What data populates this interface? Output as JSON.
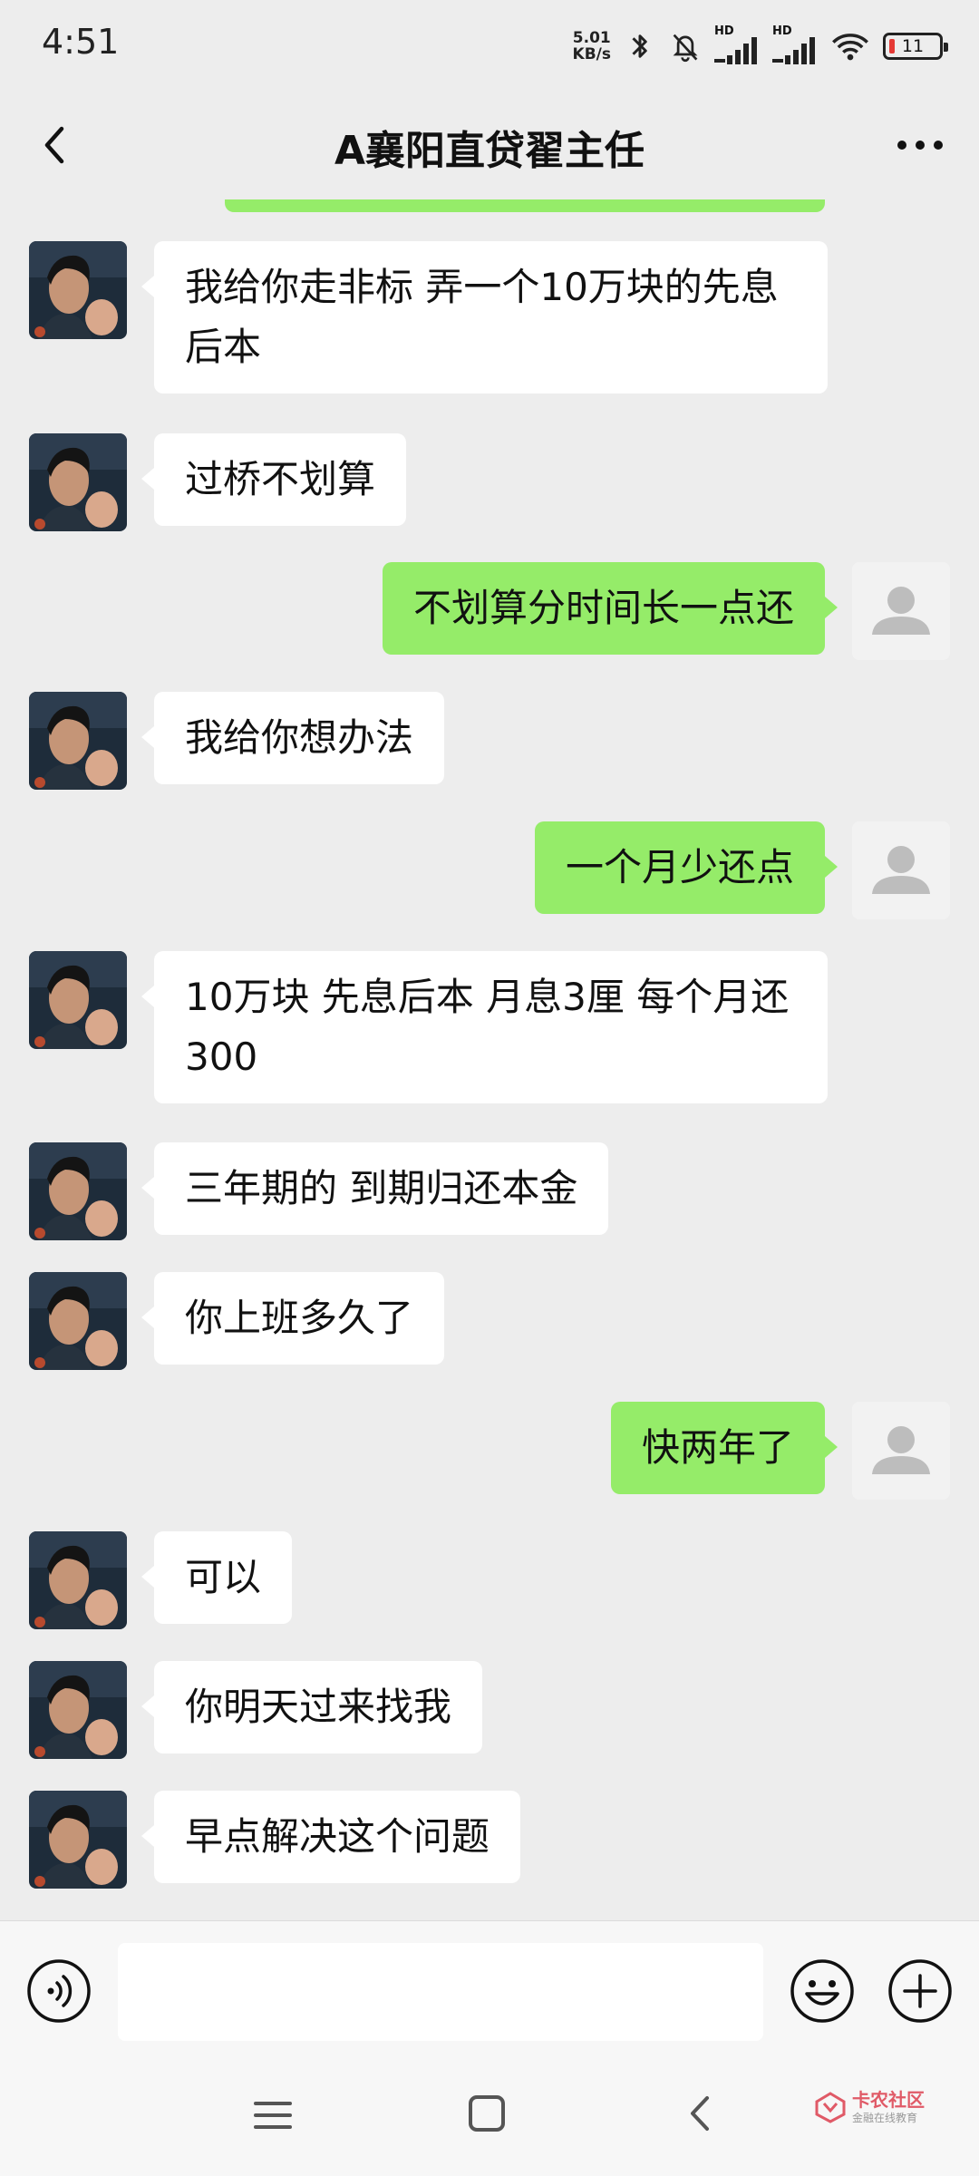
{
  "status_bar": {
    "time": "4:51",
    "net_speed_value": "5.01",
    "net_speed_unit": "KB/s",
    "signal1_label": "HD",
    "signal2_label": "HD",
    "battery_level": "11"
  },
  "header": {
    "title": "A襄阳直贷翟主任"
  },
  "messages": [
    {
      "side": "in",
      "text": "我给你走非标 弄一个10万块的先息后本"
    },
    {
      "side": "in",
      "text": "过桥不划算"
    },
    {
      "side": "out",
      "text": "不划算分时间长一点还"
    },
    {
      "side": "in",
      "text": "我给你想办法"
    },
    {
      "side": "out",
      "text": "一个月少还点"
    },
    {
      "side": "in",
      "text": "10万块 先息后本 月息3厘  每个月还300"
    },
    {
      "side": "in",
      "text": "三年期的 到期归还本金"
    },
    {
      "side": "in",
      "text": "你上班多久了"
    },
    {
      "side": "out",
      "text": "快两年了"
    },
    {
      "side": "in",
      "text": "可以"
    },
    {
      "side": "in",
      "text": "你明天过来找我"
    },
    {
      "side": "in",
      "text": "早点解决这个问题"
    }
  ],
  "input_bar": {
    "placeholder": ""
  },
  "watermark": {
    "title": "卡农社区",
    "subtitle": "金融在线教育"
  },
  "colors": {
    "background": "#ededed",
    "outgoing_bubble": "#95ec69",
    "incoming_bubble": "#ffffff"
  }
}
